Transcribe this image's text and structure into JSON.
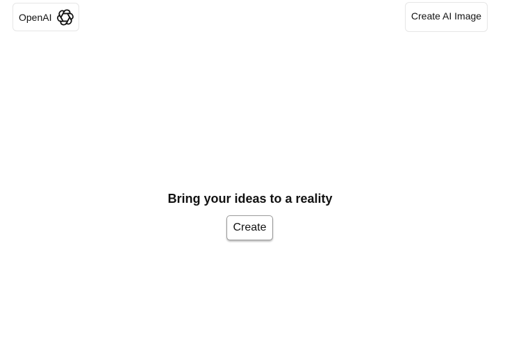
{
  "header": {
    "brand_label": "OpenAI",
    "brand_icon": "openai-logo-icon",
    "create_ai_image_label": "Create AI Image"
  },
  "hero": {
    "heading": "Bring your ideas to a reality",
    "create_label": "Create"
  }
}
